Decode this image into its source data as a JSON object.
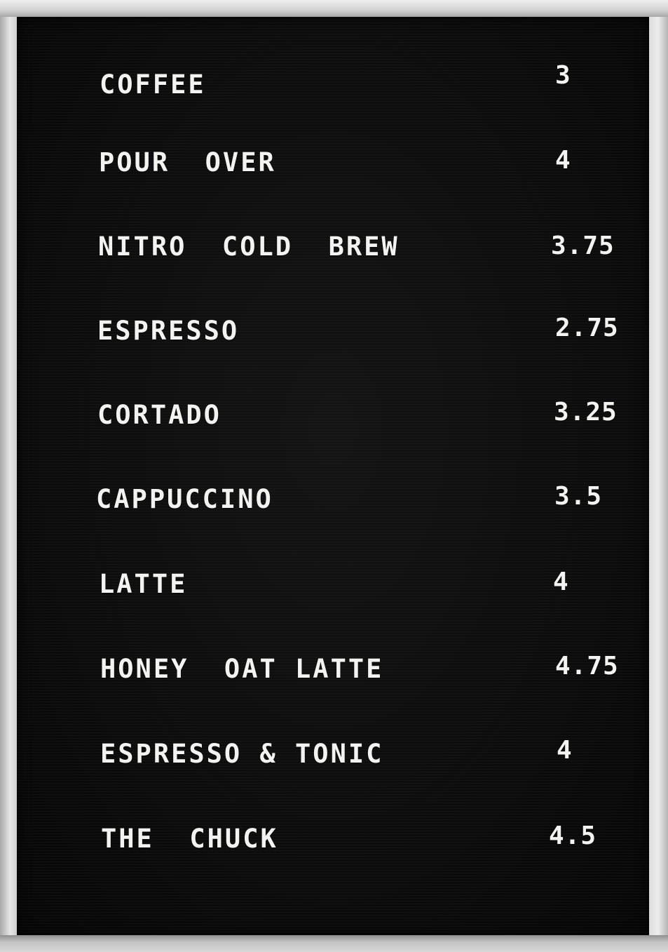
{
  "menu": {
    "items": [
      {
        "name": "COFFEE",
        "price": "3"
      },
      {
        "name": "POUR  OVER",
        "price": "4"
      },
      {
        "name": "NITRO  COLD  BREW",
        "price": "3.75"
      },
      {
        "name": "ESPRESSO",
        "price": "2.75"
      },
      {
        "name": "CORTADO",
        "price": "3.25"
      },
      {
        "name": "CAPPUCCINO",
        "price": "3.5"
      },
      {
        "name": "LATTE",
        "price": "4"
      },
      {
        "name": "HONEY  OAT LATTE",
        "price": "4.75"
      },
      {
        "name": "ESPRESSO & TONIC",
        "price": "4"
      },
      {
        "name": "THE  CHUCK",
        "price": "4.5"
      }
    ]
  }
}
